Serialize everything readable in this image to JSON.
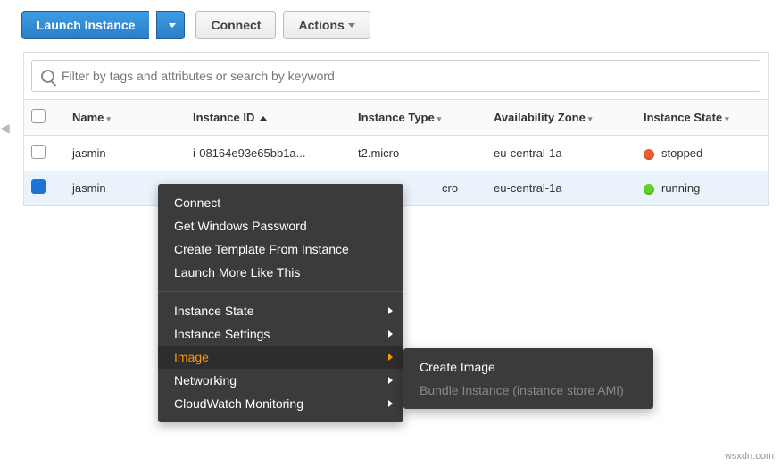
{
  "toolbar": {
    "launch_label": "Launch Instance",
    "connect_label": "Connect",
    "actions_label": "Actions"
  },
  "filter": {
    "placeholder": "Filter by tags and attributes or search by keyword"
  },
  "columns": {
    "name": "Name",
    "instance_id": "Instance ID",
    "instance_type": "Instance Type",
    "availability_zone": "Availability Zone",
    "instance_state": "Instance State"
  },
  "rows": [
    {
      "name": "jasmin",
      "instance_id": "i-08164e93e65bb1a...",
      "instance_type": "t2.micro",
      "availability_zone": "eu-central-1a",
      "state": "stopped",
      "selected": false
    },
    {
      "name": "jasmin",
      "instance_id": "",
      "instance_type": "cro",
      "availability_zone": "eu-central-1a",
      "state": "running",
      "selected": true
    }
  ],
  "context_menu": {
    "group1": {
      "connect": "Connect",
      "get_windows_password": "Get Windows Password",
      "create_template": "Create Template From Instance",
      "launch_more": "Launch More Like This"
    },
    "group2": {
      "instance_state": "Instance State",
      "instance_settings": "Instance Settings",
      "image": "Image",
      "networking": "Networking",
      "cloudwatch": "CloudWatch Monitoring"
    }
  },
  "submenu": {
    "create_image": "Create Image",
    "bundle_instance": "Bundle Instance (instance store AMI)"
  },
  "watermark": "wsxdn.com"
}
